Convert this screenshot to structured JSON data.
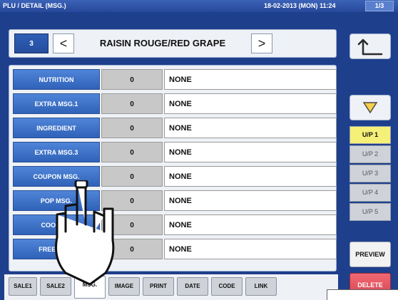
{
  "topbar": {
    "title": "PLU / DETAIL (MSG.)",
    "datetime": "18-02-2013 (MON) 11:24",
    "page": "1/3"
  },
  "header": {
    "number": "3",
    "prev": "<",
    "item_name": "RAISIN ROUGE/RED GRAPE",
    "next": ">"
  },
  "rows": [
    {
      "label": "NUTRITION",
      "value": "0",
      "text": "NONE"
    },
    {
      "label": "EXTRA MSG.1",
      "value": "0",
      "text": "NONE"
    },
    {
      "label": "INGREDIENT",
      "value": "0",
      "text": "NONE"
    },
    {
      "label": "EXTRA MSG.3",
      "value": "0",
      "text": "NONE"
    },
    {
      "label": "COUPON MSG.",
      "value": "0",
      "text": "NONE"
    },
    {
      "label": "POP MSG.",
      "value": "0",
      "text": "NONE"
    },
    {
      "label": "COOKING",
      "value": "0",
      "text": "NONE"
    },
    {
      "label": "FREE MSG.",
      "value": "0",
      "text": "NONE"
    }
  ],
  "tabs": [
    "SALE1",
    "SALE2",
    "MSG.",
    "IMAGE",
    "PRINT",
    "DATE",
    "CODE",
    "LINK"
  ],
  "active_tab": "MSG.",
  "side": {
    "unit_prices": [
      "U/P 1",
      "U/P 2",
      "U/P 3",
      "U/P 4",
      "U/P 5"
    ],
    "active_unit_price": "U/P 1",
    "preview": "PREVIEW",
    "delete": "DELETE"
  },
  "icons": {
    "back": "return-arrow-icon",
    "down": "triangle-down-icon",
    "pointer": "pointing-hand-icon"
  },
  "colors": {
    "background": "#1e3f8c",
    "label_blue": "#3a6fc6",
    "active_up": "#f4f078",
    "delete": "#e0505b"
  }
}
